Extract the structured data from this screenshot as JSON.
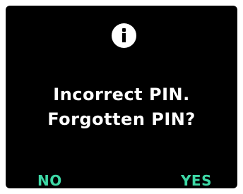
{
  "dialog": {
    "icon": "info-icon",
    "message_line1": "Incorrect PIN.",
    "message_line2": "Forgotten PIN?"
  },
  "softkeys": {
    "left_label": "NO",
    "right_label": "YES"
  },
  "colors": {
    "background": "#000000",
    "text": "#ffffff",
    "accent": "#3dd9a6"
  }
}
